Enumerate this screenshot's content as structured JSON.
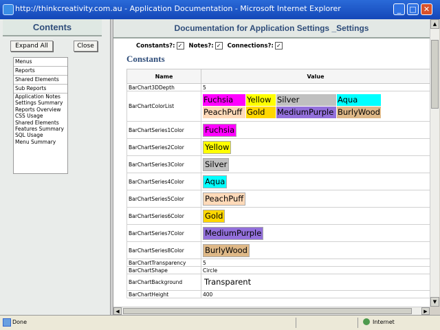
{
  "window": {
    "title": "http://thinkcreativity.com.au - Application Documentation - Microsoft Internet Explorer",
    "buttons": {
      "minimize": "_",
      "maximize": "□",
      "close": "✕"
    }
  },
  "nav": {
    "header": "Contents",
    "expand_all": "Expand All",
    "close": "Close",
    "items": [
      "Menus",
      "Reports",
      "Shared Elements",
      "Sub Reports"
    ],
    "sub_items": [
      "Application Notes",
      "Settings Summary",
      "Reports Overview",
      "CSS Usage",
      "Shared Elements",
      "Features Summary",
      "SQL Usage",
      "Menu Summary"
    ]
  },
  "doc": {
    "title": "Documentation for Application Settings _Settings",
    "options": {
      "constants": "Constants?:",
      "notes": "Notes?:",
      "connections": "Connections?:",
      "check": "✓"
    },
    "section": "Constants",
    "columns": {
      "name": "Name",
      "value": "Value"
    },
    "rows": [
      {
        "name": "BarChart3DDepth",
        "value": "5"
      },
      {
        "name": "BarChartColorList",
        "swatches": [
          {
            "label": "Fuchsia",
            "color": "#ff00ff"
          },
          {
            "label": "Yellow",
            "color": "#ffff00"
          },
          {
            "label": "Silver",
            "color": "#c0c0c0"
          },
          {
            "label": "Aqua",
            "color": "#00ffff"
          },
          {
            "label": "PeachPuff",
            "color": "#ffdab9"
          },
          {
            "label": "Gold",
            "color": "#ffd700"
          },
          {
            "label": "MediumPurple",
            "color": "#9370db"
          },
          {
            "label": "BurlyWood",
            "color": "#deb887"
          }
        ]
      },
      {
        "name": "BarChartSeries1Color",
        "value": "Fuchsia",
        "color": "#ff00ff"
      },
      {
        "name": "BarChartSeries2Color",
        "value": "Yellow",
        "color": "#ffff00"
      },
      {
        "name": "BarChartSeries3Color",
        "value": "Silver",
        "color": "#c0c0c0"
      },
      {
        "name": "BarChartSeries4Color",
        "value": "Aqua",
        "color": "#00ffff"
      },
      {
        "name": "BarChartSeries5Color",
        "value": "PeachPuff",
        "color": "#ffdab9"
      },
      {
        "name": "BarChartSeries6Color",
        "value": "Gold",
        "color": "#ffd700"
      },
      {
        "name": "BarChartSeries7Color",
        "value": "MediumPurple",
        "color": "#9370db"
      },
      {
        "name": "BarChartSeries8Color",
        "value": "BurlyWood",
        "color": "#deb887"
      },
      {
        "name": "BarChartTransparency",
        "value": "5"
      },
      {
        "name": "BarChartShape",
        "value": "Circle"
      },
      {
        "name": "BarChartBackground",
        "value": "Transparent",
        "boxed": true
      },
      {
        "name": "BarChartHeight",
        "value": "400"
      }
    ]
  },
  "status": {
    "text": "Done",
    "zone": "Internet"
  }
}
